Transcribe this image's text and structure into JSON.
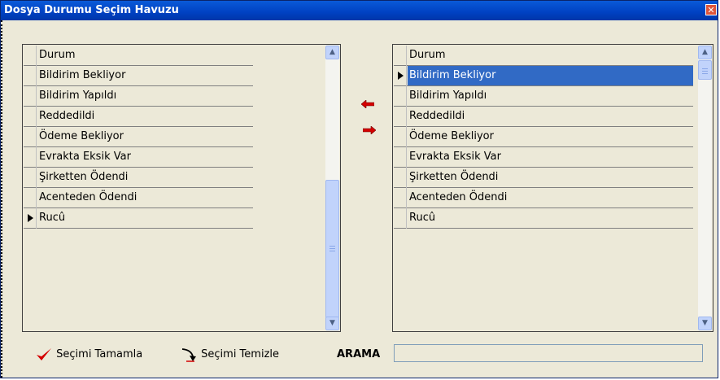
{
  "window": {
    "title": "Dosya Durumu Seçim Havuzu",
    "close_symbol": "✕"
  },
  "left_list": {
    "header": "Durum",
    "items": [
      "Bildirim Bekliyor",
      "Bildirim Yapıldı",
      "Reddedildi",
      "Ödeme Bekliyor",
      "Evrakta Eksik Var",
      "Şirketten Ödendi",
      "Acenteden Ödendi",
      "Rucû"
    ],
    "current_row": "Rucû"
  },
  "right_list": {
    "header": "Durum",
    "items": [
      "Bildirim Bekliyor",
      "Bildirim Yapıldı",
      "Reddedildi",
      "Ödeme Bekliyor",
      "Evrakta Eksik Var",
      "Şirketten Ödendi",
      "Acenteden Ödendi",
      "Rucû"
    ],
    "selected_row": "Bildirim Bekliyor"
  },
  "transfer": {
    "left_icon": "arrow-left-icon",
    "right_icon": "arrow-right-icon",
    "color": "#d40000"
  },
  "footer": {
    "complete_label": "Seçimi Tamamla",
    "clear_label": "Seçimi Temizle",
    "search_label": "ARAMA",
    "search_value": ""
  },
  "colors": {
    "titlebar": "#0041c2",
    "selection": "#316ac5",
    "panel": "#ece9d8"
  }
}
